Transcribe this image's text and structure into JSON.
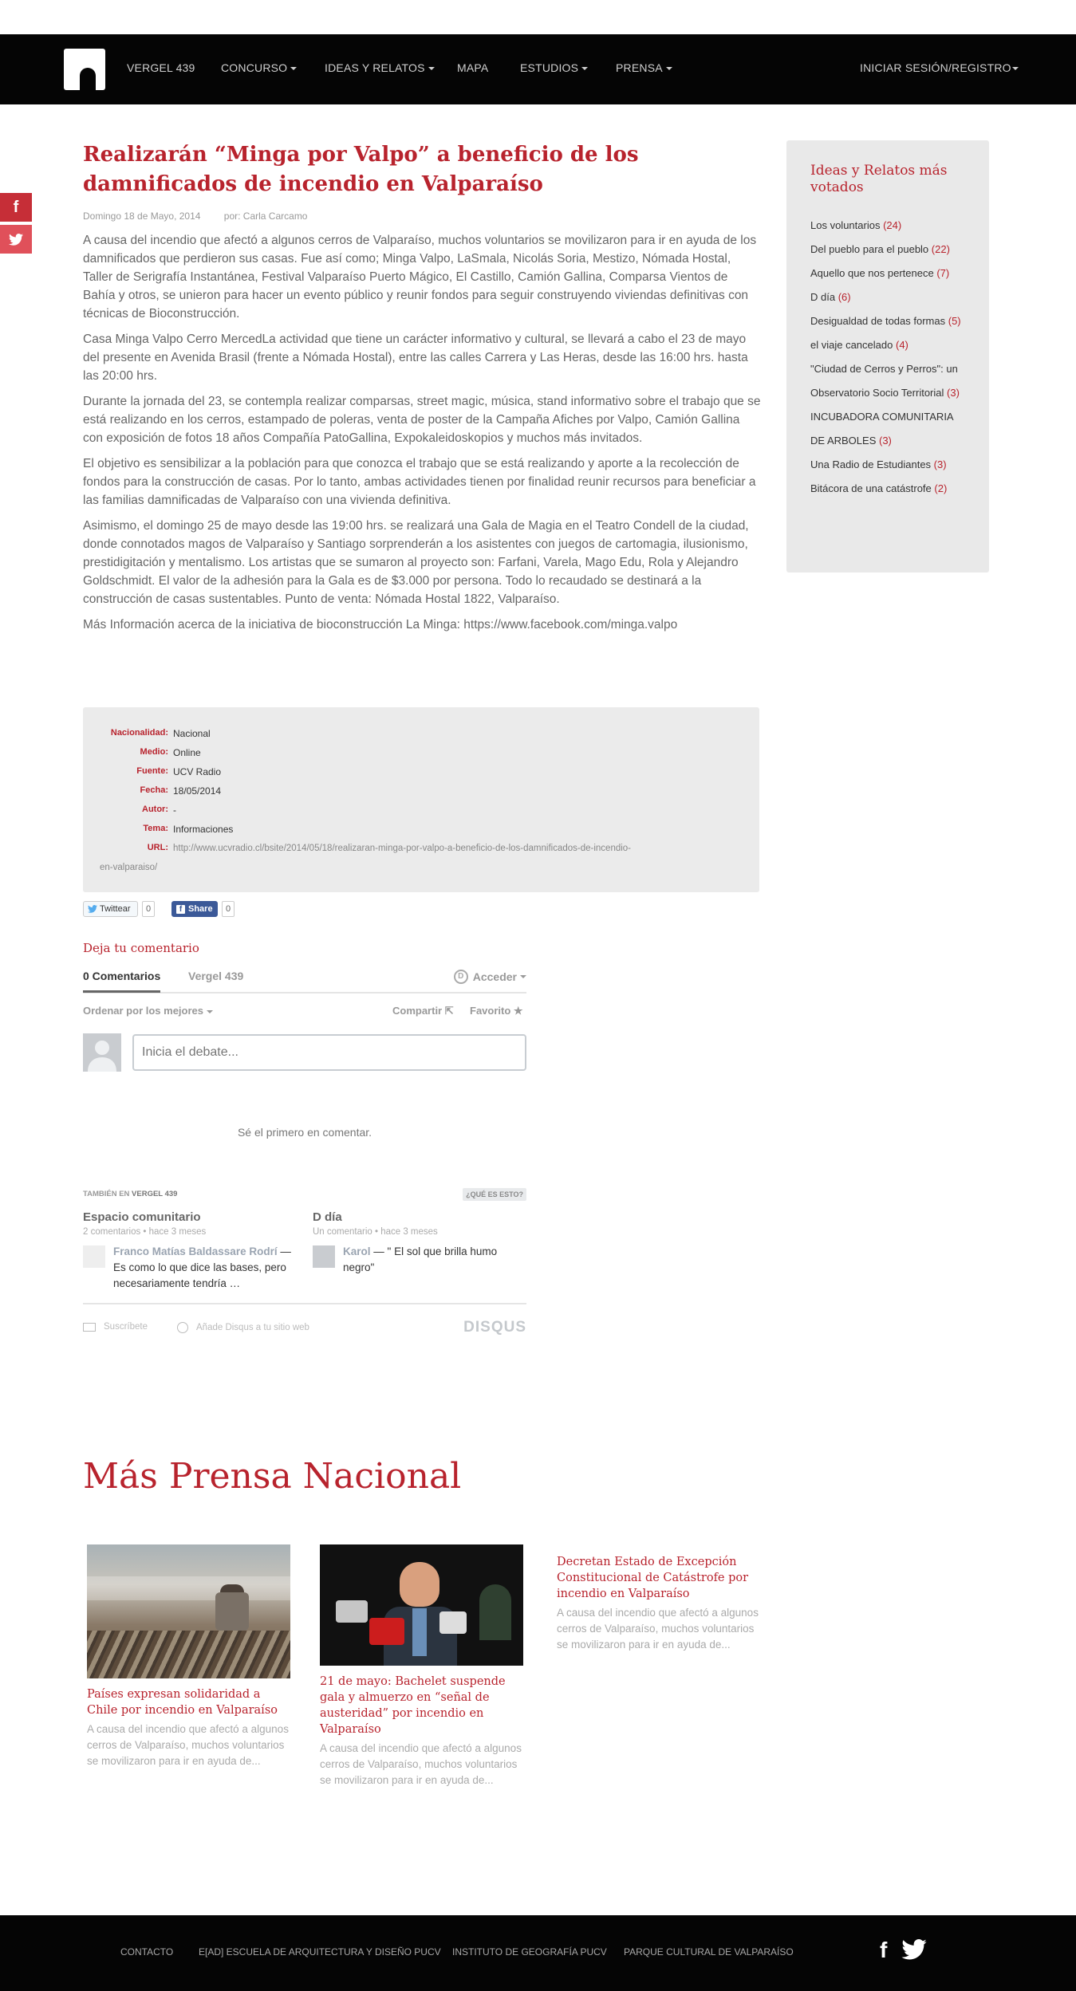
{
  "nav": {
    "items": [
      "VERGEL 439",
      "CONCURSO",
      "IDEAS Y RELATOS",
      "MAPA",
      "ESTUDIOS",
      "PRENSA"
    ],
    "login": "INICIAR SESIÓN/REGISTRO"
  },
  "social_side": {
    "facebook": "f",
    "twitter": "t"
  },
  "article": {
    "title": "Realizarán “Minga por Valpo” a beneficio de los damnificados de incendio en Valparaíso",
    "date": "Domingo 18 de Mayo, 2014",
    "author": "por: Carla Carcamo",
    "paragraphs": [
      "A causa del incendio que afectó a algunos cerros de Valparaíso, muchos voluntarios se movilizaron para ir en ayuda de los damnificados que perdieron sus casas. Fue así como; Minga Valpo, LaSmala, Nicolás Soria, Mestizo, Nómada Hostal, Taller de Serigrafía Instantánea, Festival Valparaíso Puerto Mágico, El Castillo, Camión Gallina, Comparsa Vientos de Bahía y otros, se unieron para hacer un evento público y reunir fondos para seguir construyendo viviendas definitivas con técnicas de Bioconstrucción.",
      "Casa Minga Valpo Cerro MercedLa actividad que tiene un carácter informativo y cultural, se llevará a cabo el 23 de mayo del presente en Avenida Brasil (frente a Nómada Hostal), entre las calles Carrera y Las Heras, desde las 16:00 hrs. hasta las 20:00 hrs.",
      "Durante la jornada del 23, se contempla realizar comparsas, street magic, música, stand informativo sobre el trabajo que se está realizando en los cerros, estampado de poleras, venta de poster de la Campaña Afiches por Valpo, Camión Gallina con exposición de fotos 18 años Compañía PatoGallina, Expokaleidoskopios y muchos más invitados.",
      "El objetivo es sensibilizar a la población para que conozca el trabajo que se está realizando y aporte a la recolección de fondos para la construcción de casas. Por lo tanto, ambas actividades tienen por finalidad reunir recursos para beneficiar a las familias damnificadas de Valparaíso con una vivienda definitiva.",
      "Asimismo, el domingo 25 de mayo desde las 19:00 hrs. se realizará una Gala de Magia en el Teatro Condell de la ciudad, donde connotados magos de Valparaíso y Santiago sorprenderán a los asistentes con juegos de cartomagia, ilusionismo, prestidigitación y mentalismo. Los artistas que se sumaron al proyecto son: Farfani, Varela, Mago Edu, Rola y Alejandro Goldschmidt. El valor de la adhesión para la Gala es de $3.000 por persona. Todo lo recaudado se destinará a la construcción de casas sustentables. Punto de venta: Nómada Hostal 1822, Valparaíso.",
      "Más Información acerca de la iniciativa de bioconstrucción La Minga: https://www.facebook.com/minga.valpo"
    ]
  },
  "sidebar": {
    "title": "Ideas y Relatos más votados",
    "items": [
      {
        "label": "Los voluntarios",
        "count": "(24)"
      },
      {
        "label": "Del pueblo para el pueblo",
        "count": "(22)"
      },
      {
        "label": "Aquello que nos pertenece",
        "count": "(7)"
      },
      {
        "label": "D día",
        "count": "(6)"
      },
      {
        "label": "Desigualdad de todas formas",
        "count": "(5)"
      },
      {
        "label": "el viaje cancelado",
        "count": "(4)"
      },
      {
        "label": "\"Ciudad de Cerros y Perros\": un Observatorio Socio Territorial",
        "count": "(3)"
      },
      {
        "label": "INCUBADORA COMUNITARIA DE ARBOLES",
        "count": "(3)"
      },
      {
        "label": "Una Radio de Estudiantes",
        "count": "(3)"
      },
      {
        "label": "Bitácora de una catástrofe",
        "count": "(2)"
      }
    ]
  },
  "info": {
    "nacionalidad_k": "Nacionalidad:",
    "nacionalidad_v": "Nacional",
    "medio_k": "Medio:",
    "medio_v": "Online",
    "fuente_k": "Fuente:",
    "fuente_v": "UCV Radio",
    "fecha_k": "Fecha:",
    "fecha_v": "18/05/2014",
    "autor_k": "Autor:",
    "autor_v": "-",
    "tema_k": "Tema:",
    "tema_v": "Informaciones",
    "url_k": "URL:",
    "url_v1": "http://www.ucvradio.cl/bsite/2014/05/18/realizaran-minga-por-valpo-a-beneficio-de-los-damnificados-de-incendio-",
    "url_v2": "en-valparaiso/"
  },
  "share": {
    "twitter_label": "Twittear",
    "twitter_count": "0",
    "facebook_label": "Share",
    "facebook_count": "0"
  },
  "comments": {
    "heading": "Deja tu comentario",
    "tab_count": "0 Comentarios",
    "tab_site": "Vergel 439",
    "login": "Acceder",
    "sort": "Ordenar por los mejores",
    "share": "Compartir",
    "favorite": "Favorito",
    "input_placeholder": "Inicia el debate...",
    "empty": "Sé el primero en comentar.",
    "also_prefix": "TAMBIÉN EN",
    "also_site": "VERGEL 439",
    "what_is": "¿QUÉ ES ESTO?",
    "related": [
      {
        "title": "Espacio comunitario",
        "meta": "2 comentarios • hace 3 meses",
        "user": "Franco Matías Baldassare Rodrí",
        "text": "Es como lo que dice las bases, pero necesariamente tendría …"
      },
      {
        "title": "D día",
        "meta": "Un comentario • hace 3 meses",
        "user": "Karol",
        "text": "\" El sol que brilla humo negro\""
      }
    ],
    "subscribe": "Suscríbete",
    "add_disqus": "Añade Disqus a tu sitio web",
    "brand": "DISQUS"
  },
  "more": {
    "title": "Más Prensa Nacional",
    "cards": [
      {
        "title": "Países expresan solidaridad a Chile por incendio en Valparaíso",
        "excerpt": "A causa del incendio que afectó a algunos cerros de Valparaíso, muchos voluntarios se movilizaron para ir en ayuda de..."
      },
      {
        "title": "21 de mayo: Bachelet suspende gala y almuerzo en “señal de austeridad” por incendio en Valparaíso",
        "excerpt": "A causa del incendio que afectó a algunos cerros de Valparaíso, muchos voluntarios se movilizaron para ir en ayuda de..."
      },
      {
        "title": "Decretan Estado de Excepción Constitucional de Catástrofe por incendio en Valparaíso",
        "excerpt": "A causa del incendio que afectó a algunos cerros de Valparaíso, muchos voluntarios se movilizaron para ir en ayuda de..."
      }
    ]
  },
  "footer": {
    "links": [
      "CONTACTO",
      "E[AD] ESCUELA DE ARQUITECTURA Y DISEÑO PUCV",
      "INSTITUTO DE GEOGRAFÍA PUCV",
      "PARQUE CULTURAL DE VALPARAÍSO"
    ],
    "facebook": "f"
  },
  "colors": {
    "accent": "#b8232d",
    "nav_bg": "#050505",
    "facebook": "#3b5998",
    "twitter": "#55acee"
  }
}
